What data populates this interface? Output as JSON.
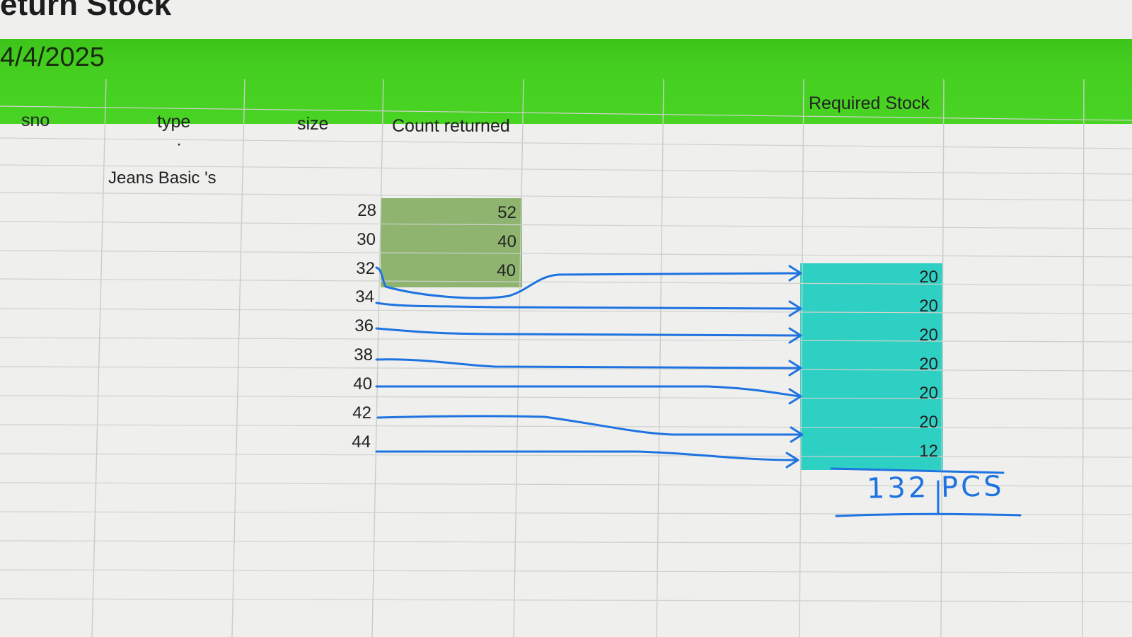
{
  "sheet": {
    "title": "eturn Stock",
    "date": "4/4/2025"
  },
  "columns": {
    "sno": "sno",
    "type": "type",
    "size": "size",
    "count_returned": "Count returned",
    "required_stock": "Required Stock"
  },
  "rows": {
    "dot": "·",
    "type_value": "Jeans Basic 's"
  },
  "sizes": [
    "28",
    "30",
    "32",
    "34",
    "36",
    "38",
    "40",
    "42",
    "44"
  ],
  "counts_returned": [
    "52",
    "40",
    "40"
  ],
  "required_stock_values": [
    "20",
    "20",
    "20",
    "20",
    "20",
    "20",
    "12"
  ],
  "handwritten_total": "132 PCS",
  "colors": {
    "header_band": "#45d021",
    "count_fill": "#8fb470",
    "required_fill": "#2fd0c4",
    "ink": "#1e73e0"
  }
}
